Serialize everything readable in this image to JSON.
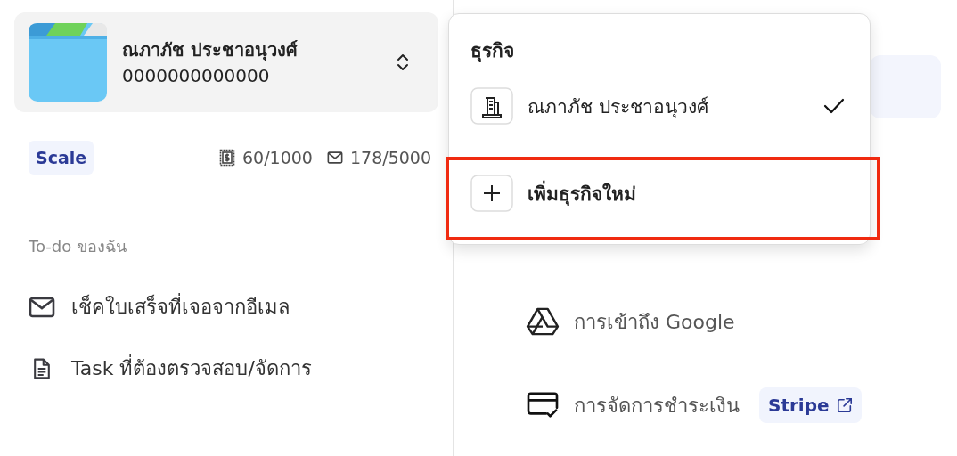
{
  "business_switcher": {
    "name": "ณภาภัช ประชาอนุวงศ์",
    "number": "0000000000000"
  },
  "plan": {
    "badge": "Scale",
    "receipts": "60/1000",
    "emails": "178/5000"
  },
  "todo": {
    "heading": "To-do ของฉัน",
    "items": [
      {
        "kind": "email",
        "label": "เช็คใบเสร็จที่เจอจากอีเมล"
      },
      {
        "kind": "document",
        "label": "Task ที่ต้องตรวจสอบ/จัดการ"
      }
    ]
  },
  "settings_menu": {
    "items": [
      {
        "kind": "google",
        "label": "การเข้าถึง Google"
      },
      {
        "kind": "billing",
        "label": "การจัดการชำระเงิน",
        "link": "Stripe"
      }
    ]
  },
  "business_menu": {
    "title": "ธุรกิจ",
    "businesses": [
      {
        "name": "ณภาภัช ประชาอนุวงศ์",
        "selected": true
      }
    ],
    "add_label": "เพิ่มธุรกิจใหม่",
    "add_highlighted": true
  }
}
